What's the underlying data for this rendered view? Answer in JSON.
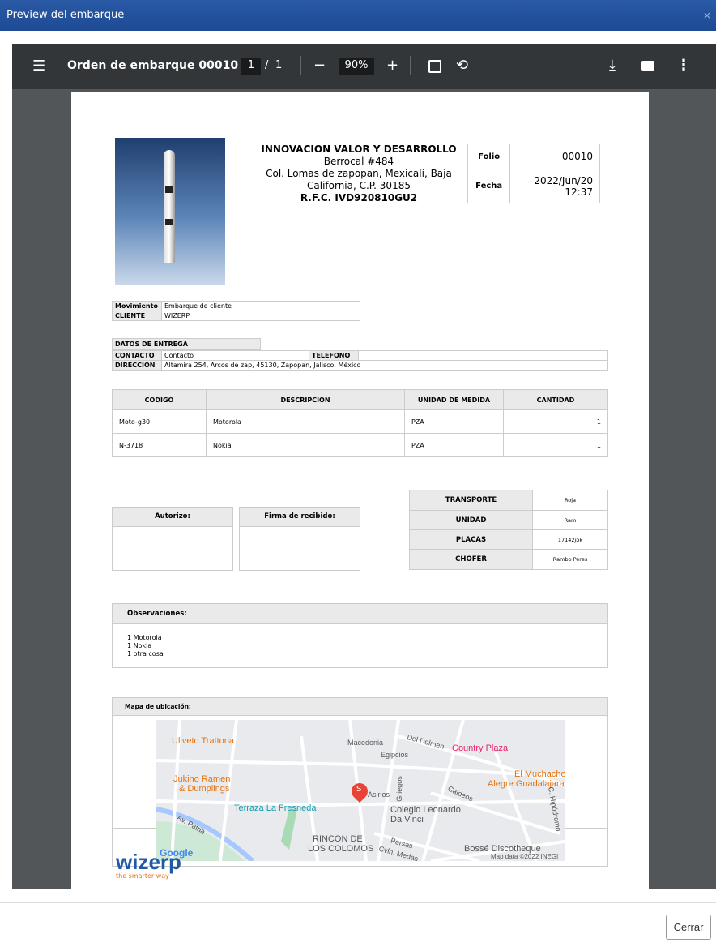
{
  "dialog": {
    "title": "Preview del embarque",
    "close": "×",
    "cerrar": "Cerrar"
  },
  "viewer": {
    "doc_title": "Orden de embarque 00010",
    "page": "1",
    "page_sep": "/",
    "total": "1",
    "zoom": "90%"
  },
  "company": {
    "name": "INNOVACION VALOR Y DESARROLLO",
    "line1": "Berrocal #484",
    "line2": "Col. Lomas de zapopan, Mexicali, Baja",
    "line3": "California, C.P. 30185",
    "rfc": "R.F.C. IVD920810GU2"
  },
  "folio": {
    "folio_label": "Folio",
    "folio": "00010",
    "fecha_label": "Fecha",
    "fecha1": "2022/Jun/20",
    "fecha2": "12:37"
  },
  "mov": {
    "mov_label": "Movimiento",
    "mov": "Embarque de cliente",
    "cliente_label": "CLIENTE",
    "cliente": "WIZERP"
  },
  "entrega": {
    "title": "DATOS DE ENTREGA",
    "contacto_label": "CONTACTO",
    "contacto": "Contacto",
    "telefono_label": "TELEFONO",
    "telefono": "",
    "direccion_label": "DIRECCION",
    "direccion": "Altamira 254, Arcos de zap, 45130, Zapopan, Jalisco, México"
  },
  "items": {
    "headers": [
      "CODIGO",
      "DESCRIPCION",
      "UNIDAD DE MEDIDA",
      "CANTIDAD"
    ],
    "rows": [
      [
        "Moto-g30",
        "Motorola",
        "PZA",
        "1"
      ],
      [
        "N-3718",
        "Nokia",
        "PZA",
        "1"
      ]
    ]
  },
  "firmas": {
    "autorizo": "Autorizo:",
    "recibido": "Firma de recibido:"
  },
  "transporte": {
    "rows": [
      [
        "TRANSPORTE",
        "Roja"
      ],
      [
        "UNIDAD",
        "Ram"
      ],
      [
        "PLACAS",
        "17142jpk"
      ],
      [
        "CHOFER",
        "Rambo Peres"
      ]
    ]
  },
  "obs": {
    "title": "Observaciones:",
    "lines": [
      "1 Motorola",
      "1 Nokia",
      "1 otra cosa"
    ]
  },
  "mapa": {
    "title": "Mapa de ubicación:",
    "labels": [
      "Uliveto Trattoria",
      "Macedonia",
      "Del Dolmen",
      "Country Plaza",
      "Egipcios",
      "Jukino Ramen",
      "& Dumplings",
      "El Muchacho",
      "Alegre Guadalajara...",
      "Griegos",
      "Asirios",
      "Caldeos",
      "Terraza La Fresneda",
      "Colegio Leonardo",
      "Da Vinci",
      "Av. Patria",
      "Persas",
      "Cvln. Medas",
      "C. Hipódromo",
      "RINCON DE",
      "LOS COLOMOS",
      "Bossé Discotheque",
      "Map data ©2022 INEGI"
    ],
    "pin": "S",
    "google": "Google"
  },
  "logo": {
    "name": "wizerp",
    "tagline": "the smarter way"
  }
}
